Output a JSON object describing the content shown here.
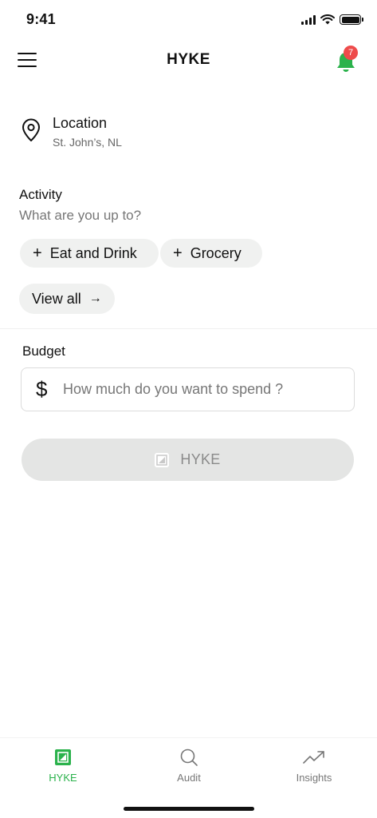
{
  "status_bar": {
    "time": "9:41"
  },
  "header": {
    "title": "HYKE",
    "notification_count": "7"
  },
  "location": {
    "label": "Location",
    "value": "St. John’s, NL"
  },
  "activity": {
    "title": "Activity",
    "subtitle": "What are you up to?",
    "chips": [
      {
        "label": "Eat and Drink"
      },
      {
        "label": "Grocery"
      }
    ],
    "view_all": "View all"
  },
  "budget": {
    "title": "Budget",
    "currency_symbol": "$",
    "placeholder": "How much do you want to spend ?"
  },
  "submit": {
    "label": "HYKE"
  },
  "bottom_nav": {
    "items": [
      {
        "label": "HYKE",
        "icon": "hyke-logo-icon",
        "active": true
      },
      {
        "label": "Audit",
        "icon": "search-icon",
        "active": false
      },
      {
        "label": "Insights",
        "icon": "trending-up-icon",
        "active": false
      }
    ]
  },
  "colors": {
    "accent_green": "#2bb24c",
    "badge_red": "#ee4b4b",
    "button_disabled": "#e4e5e4"
  }
}
